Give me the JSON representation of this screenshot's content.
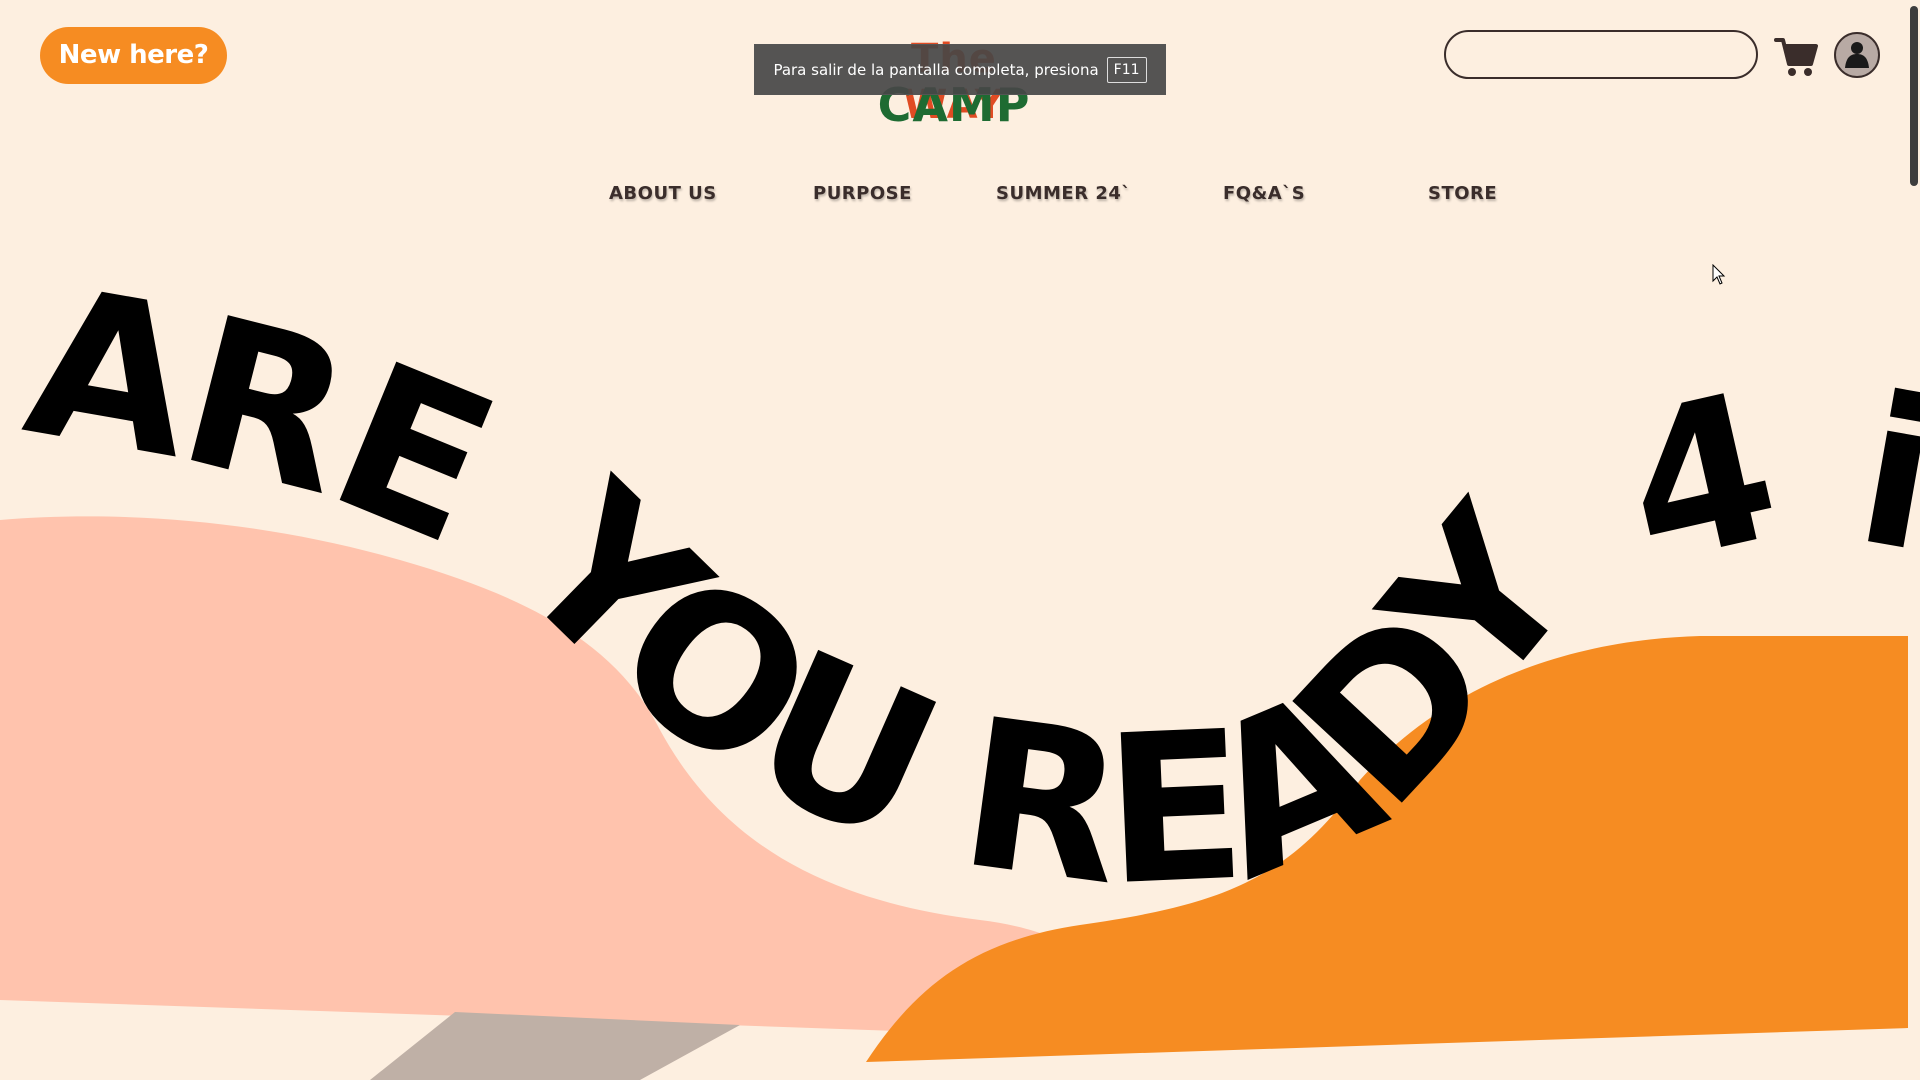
{
  "header": {
    "new_here_label": "New here?",
    "logo_top": "The WAY",
    "logo_bottom": "CAMP",
    "search_value": "",
    "search_placeholder": ""
  },
  "fullscreen_notice": {
    "text": "Para salir de la pantalla completa, presiona",
    "key": "F11"
  },
  "nav": {
    "items": [
      {
        "label": "ABOUT US"
      },
      {
        "label": "PURPOSE"
      },
      {
        "label": "SUMMER 24`"
      },
      {
        "label": "FQ&A`S"
      },
      {
        "label": "STORE"
      }
    ]
  },
  "hero": {
    "headline_words": [
      "ARE",
      "YOU",
      "READY",
      "4",
      "iT?"
    ]
  },
  "colors": {
    "background": "#fdefe0",
    "accent_orange": "#f68c22",
    "hill_pink": "#ffc3ad",
    "hill_gray": "#bfb0a6",
    "text_dark": "#3a2d2b",
    "logo_red": "#e04b23",
    "logo_green": "#1e6b32"
  },
  "icons": {
    "cart": "cart-icon",
    "user": "user-icon",
    "cursor": "mouse-cursor-icon"
  }
}
